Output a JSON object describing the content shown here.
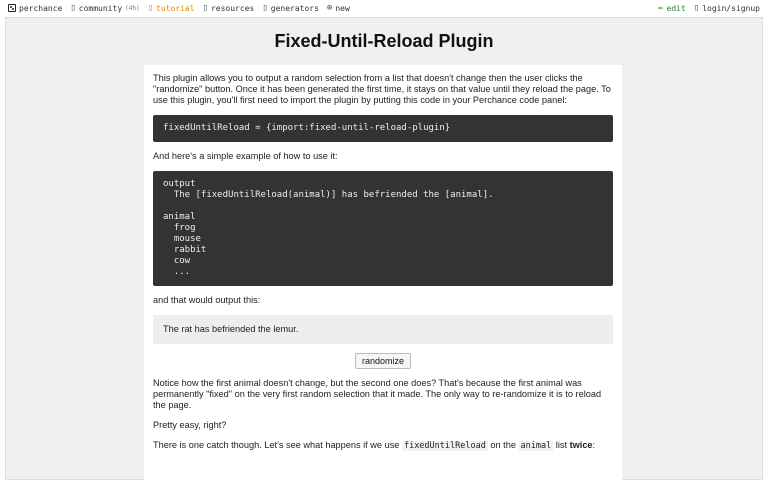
{
  "nav": {
    "left": [
      {
        "name": "perchance",
        "label": "perchance"
      },
      {
        "name": "community",
        "label": "community",
        "badge": "(4h)"
      },
      {
        "name": "tutorial",
        "label": "tutorial"
      },
      {
        "name": "resources",
        "label": "resources"
      },
      {
        "name": "generators",
        "label": "generators"
      },
      {
        "name": "new",
        "label": "new"
      }
    ],
    "edit_label": "edit",
    "login_label": "login/signup"
  },
  "page": {
    "title": "Fixed-Until-Reload Plugin",
    "intro": "This plugin allows you to output a random selection from a list that doesn't change then the user clicks the \"randomize\" button. Once it has been generated the first time, it stays on that value until they reload the page. To use this plugin, you'll first need to import the plugin by putting this code in your Perchance code panel:",
    "import_code": "fixedUntilReload = {import:fixed-until-reload-plugin}",
    "example_intro": "And here's a simple example of how to use it:",
    "example_code": "output\n  The [fixedUntilReload(animal)] has befriended the [animal].\n\nanimal\n  frog\n  mouse\n  rabbit\n  cow\n  ...",
    "output_intro": "and that would output this:",
    "output_text": "The rat has befriended the lemur.",
    "randomize_label": "randomize",
    "explanation": "Notice how the first animal doesn't change, but the second one does? That's because the first animal was permanently \"fixed\" on the very first random selection that it made. The only way to re-randomize it is to reload the page.",
    "easy": "Pretty easy, right?",
    "catch_prefix": "There is one catch though. Let's see what happens if we use ",
    "catch_code1": "fixedUntilReload",
    "catch_mid": " on the ",
    "catch_code2": "animal",
    "catch_suffix": " list ",
    "catch_bold": "twice",
    "catch_end": ":"
  }
}
